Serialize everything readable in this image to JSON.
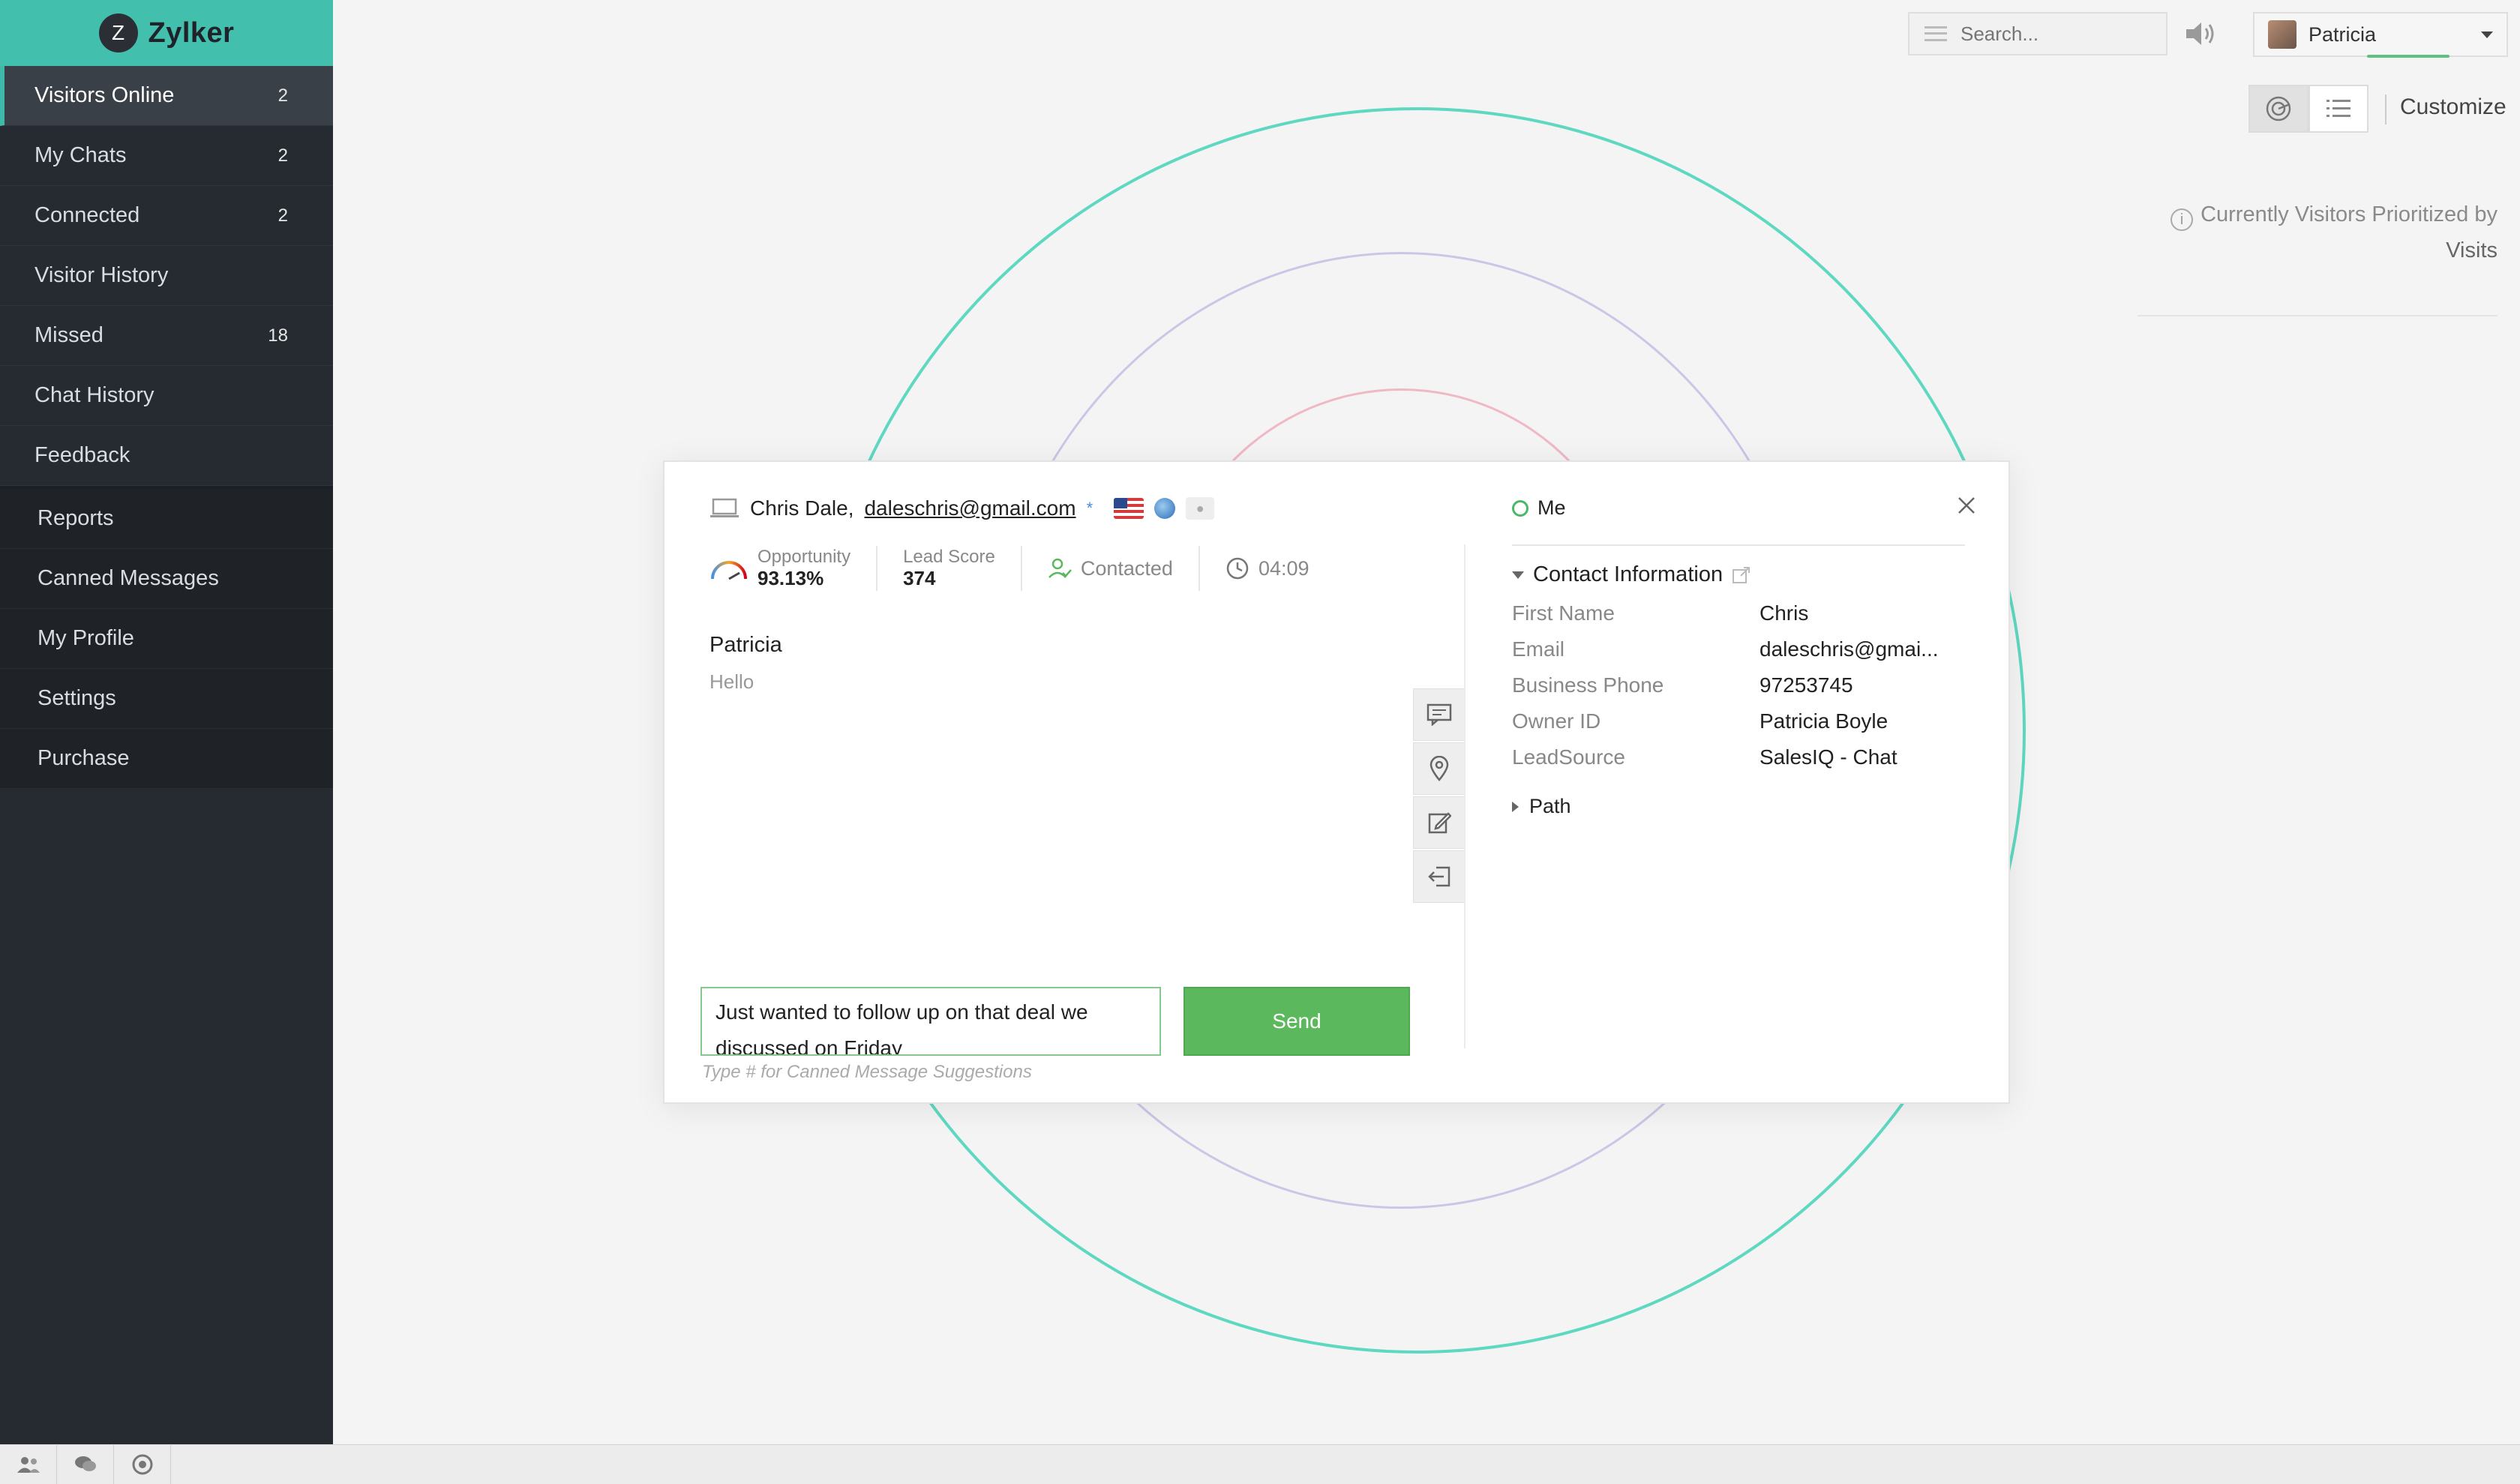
{
  "brand": {
    "initial": "Z",
    "name": "Zylker"
  },
  "sidebar": {
    "items": [
      {
        "label": "Visitors Online",
        "count": "2"
      },
      {
        "label": "My Chats",
        "count": "2"
      },
      {
        "label": "Connected",
        "count": "2"
      },
      {
        "label": "Visitor History",
        "count": ""
      },
      {
        "label": "Missed",
        "count": "18"
      },
      {
        "label": "Chat History",
        "count": ""
      },
      {
        "label": "Feedback",
        "count": ""
      }
    ],
    "secondary": [
      {
        "label": "Reports"
      },
      {
        "label": "Canned Messages"
      },
      {
        "label": "My Profile"
      },
      {
        "label": "Settings"
      },
      {
        "label": "Purchase"
      }
    ]
  },
  "topbar": {
    "search_placeholder": "Search...",
    "user_name": "Patricia",
    "customize_label": "Customize"
  },
  "priority": {
    "line1": "Currently Visitors Prioritized by",
    "line2": "Visits",
    "info_glyph": "i"
  },
  "colors": {
    "accent": "#43bfae",
    "ring_outer": "#5fd8c2",
    "ring_middle": "#c9c7e6",
    "ring_inner": "#f0b8c4",
    "send": "#5cb85c"
  },
  "chat": {
    "visitor_name": "Chris Dale,",
    "visitor_email": "daleschris@gmail.com",
    "star": "*",
    "stats": {
      "opportunity_label": "Opportunity",
      "opportunity_value": "93.13%",
      "lead_label": "Lead Score",
      "lead_value": "374",
      "status": "Contacted",
      "timer": "04:09"
    },
    "message_author": "Patricia",
    "message_text": "Hello",
    "composer_value": "Just wanted to follow up on that deal we discussed on Friday",
    "send_label": "Send",
    "hint": "Type # for Canned Message Suggestions"
  },
  "contact": {
    "owner_label": "Me",
    "section_title": "Contact Information",
    "fields": [
      {
        "key": "First Name",
        "value": "Chris"
      },
      {
        "key": "Email",
        "value": "daleschris@gmai..."
      },
      {
        "key": "Business Phone",
        "value": "97253745"
      },
      {
        "key": "Owner ID",
        "value": "Patricia Boyle"
      },
      {
        "key": "LeadSource",
        "value": "SalesIQ - Chat"
      }
    ],
    "path_label": "Path"
  }
}
